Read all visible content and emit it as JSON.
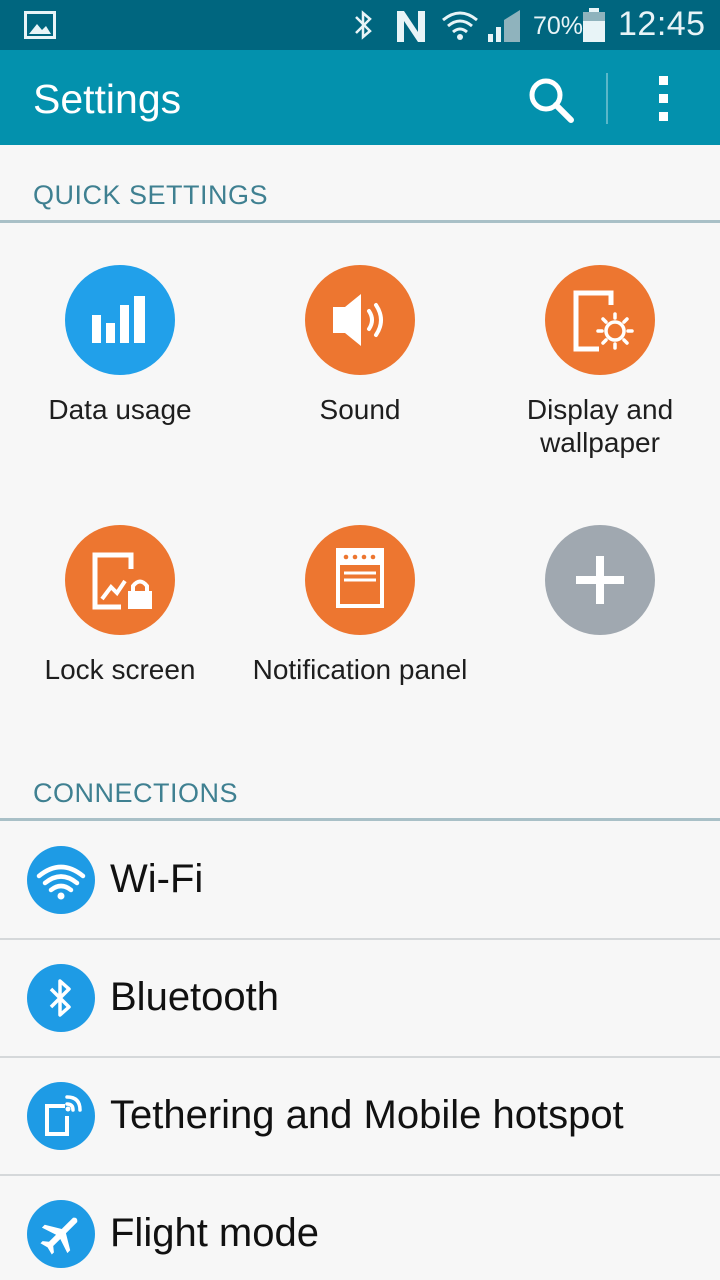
{
  "status_bar": {
    "battery_pct": "70%",
    "time": "12:45",
    "icons": [
      "picture-icon",
      "bluetooth-icon",
      "nfc-icon",
      "wifi-icon",
      "signal-icon",
      "battery-icon"
    ]
  },
  "action_bar": {
    "title": "Settings",
    "search_icon": "search-icon",
    "more_icon": "more-vertical-icon",
    "color": "#0391ad"
  },
  "quick_settings": {
    "header": "QUICK SETTINGS",
    "tiles": [
      {
        "label": "Data usage",
        "icon": "data-usage-icon",
        "color": "#21a0ea"
      },
      {
        "label": "Sound",
        "icon": "sound-icon",
        "color": "#ed7630"
      },
      {
        "label": "Display and wallpaper",
        "icon": "display-icon",
        "color": "#ed7630"
      },
      {
        "label": "Lock screen",
        "icon": "lock-screen-icon",
        "color": "#ed7630"
      },
      {
        "label": "Notification panel",
        "icon": "notification-panel-icon",
        "color": "#ed7630"
      },
      {
        "label": "",
        "icon": "add-icon",
        "color": "#a0a8b0"
      }
    ]
  },
  "connections": {
    "header": "CONNECTIONS",
    "items": [
      {
        "label": "Wi-Fi",
        "icon": "wifi-icon"
      },
      {
        "label": "Bluetooth",
        "icon": "bluetooth-icon"
      },
      {
        "label": "Tethering and Mobile hotspot",
        "icon": "hotspot-icon"
      },
      {
        "label": "Flight mode",
        "icon": "airplane-icon"
      }
    ],
    "icon_color": "#1e9be5"
  }
}
